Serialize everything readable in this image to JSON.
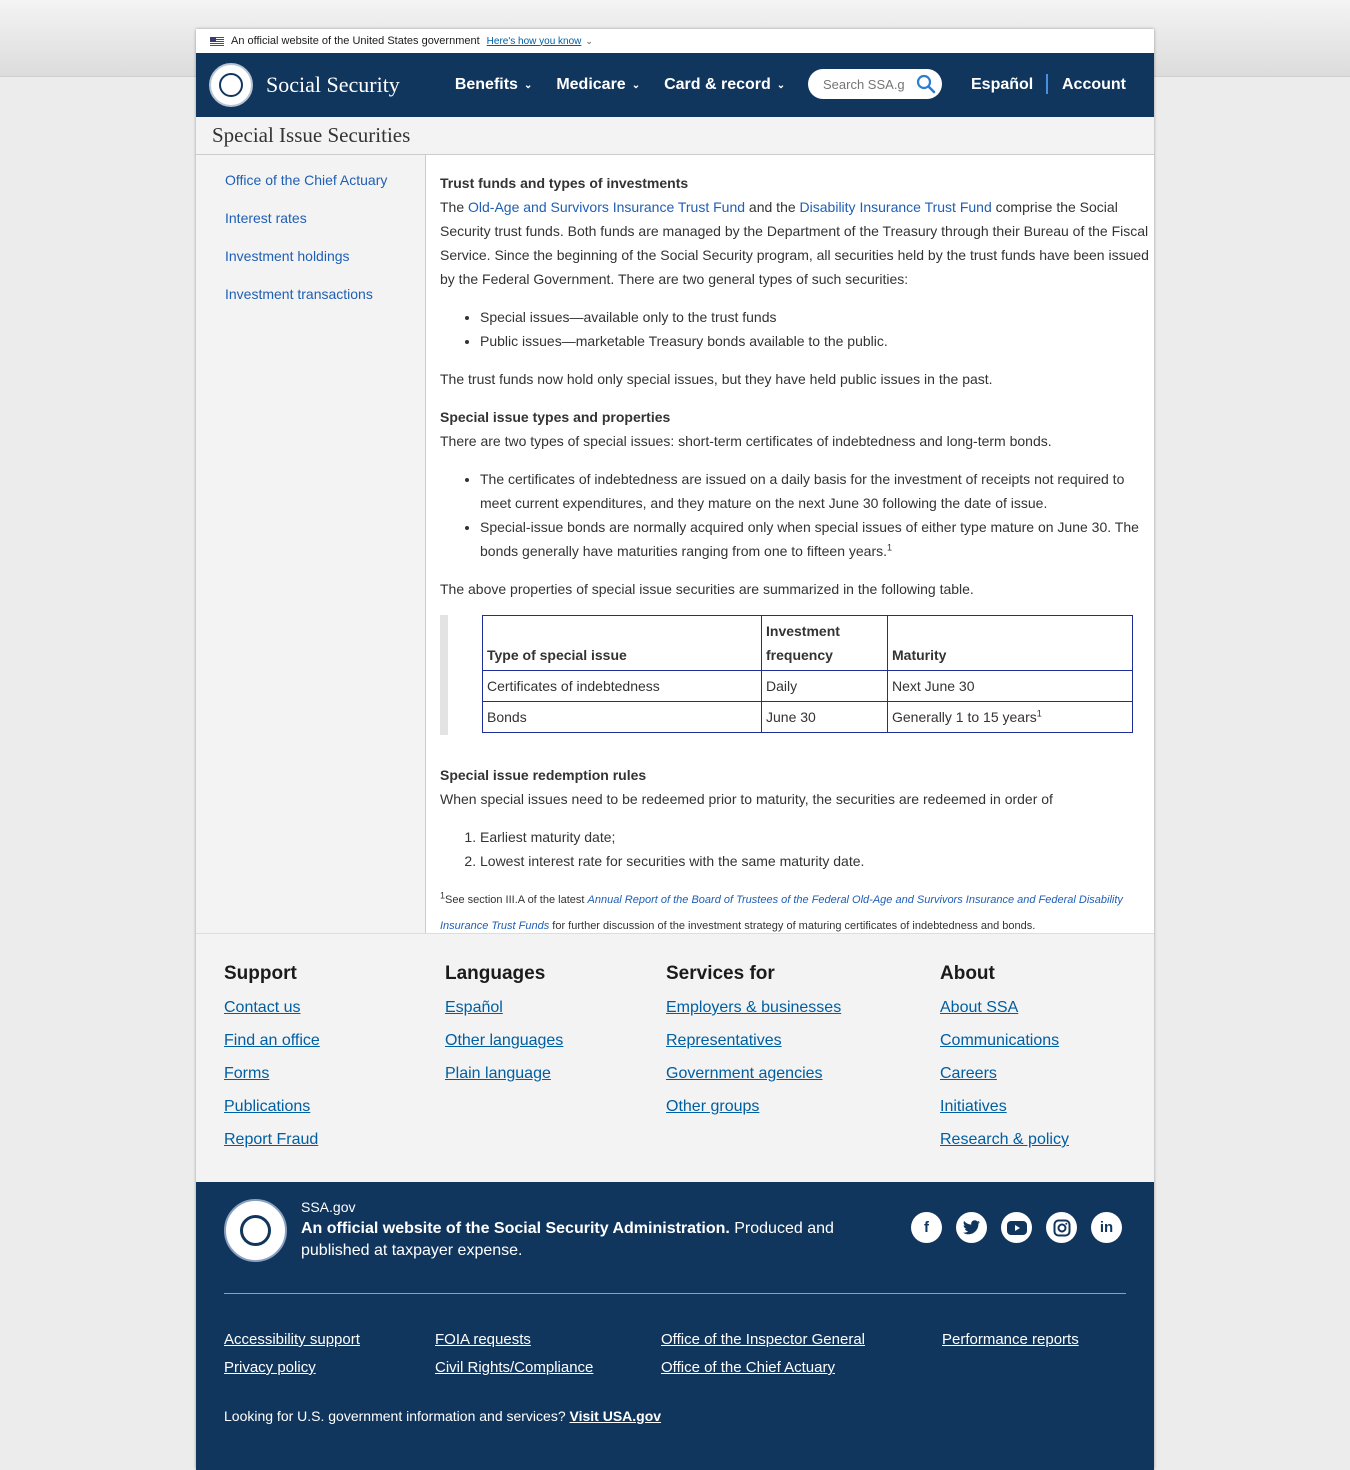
{
  "banner": {
    "text": "An official website of the United States government",
    "how_link": "Here's how you know"
  },
  "header": {
    "brand": "Social Security",
    "nav": [
      "Benefits",
      "Medicare",
      "Card & record"
    ],
    "search_placeholder": "Search SSA.gov",
    "espanol": "Español",
    "account": "Account"
  },
  "page_title": "Special Issue Securities",
  "sidebar": [
    "Office of the Chief Actuary",
    "Interest rates",
    "Investment holdings",
    "Investment transactions"
  ],
  "main": {
    "h1": "Trust funds and types of investments",
    "p1_a": "The ",
    "p1_link1": "Old-Age and Survivors Insurance Trust Fund",
    "p1_b": " and the ",
    "p1_link2": "Disability Insurance Trust Fund",
    "p1_c": " comprise the Social Security trust funds. Both funds are managed by the Department of the Treasury through their Bureau of the Fiscal Service. Since the beginning of the Social Security program, all securities held by the trust funds have been issued by the Federal Government. There are two general types of such securities:",
    "list1": [
      "Special issues—available only to the trust funds",
      "Public issues—marketable Treasury bonds available to the public."
    ],
    "p2": "The trust funds now hold only special issues, but they have held public issues in the past.",
    "h2": "Special issue types and properties",
    "p3": "There are two types of special issues: short-term certificates of indebtedness and long-term bonds.",
    "list2": [
      "The certificates of indebtedness are issued on a daily basis for the investment of receipts not required to meet current expenditures, and they mature on the next June 30 following the date of issue.",
      "Special-issue bonds are normally acquired only when special issues of either type mature on June 30. The bonds generally have maturities ranging from one to fifteen years."
    ],
    "sup": "1",
    "p4": "The above properties of special issue securities are summarized in the following table.",
    "table": {
      "headers": [
        "Type of special issue",
        "Investment frequency",
        "Maturity"
      ],
      "rows": [
        [
          "Certificates of indebtedness",
          "Daily",
          "Next June 30"
        ],
        [
          "Bonds",
          "June 30",
          "Generally 1 to 15 years"
        ]
      ]
    },
    "h3": "Special issue redemption rules",
    "p5": "When special issues need to be redeemed prior to maturity, the securities are redeemed in order of",
    "list3": [
      "Earliest maturity date;",
      "Lowest interest rate for securities with the same maturity date."
    ],
    "fn_a": "See section III.A of the latest ",
    "fn_link": "Annual Report of the Board of Trustees of the Federal Old-Age and Survivors Insurance and Federal Disability Insurance Trust Funds",
    "fn_b": " for further discussion of the investment strategy of maturing certificates of indebtedness and bonds."
  },
  "footer": {
    "cols": [
      {
        "title": "Support",
        "links": [
          "Contact us",
          "Find an office",
          "Forms",
          "Publications",
          "Report Fraud"
        ]
      },
      {
        "title": "Languages",
        "links": [
          "Español",
          "Other languages",
          "Plain language"
        ]
      },
      {
        "title": "Services for",
        "links": [
          "Employers & businesses",
          "Representatives",
          "Government agencies",
          "Other groups"
        ]
      },
      {
        "title": "About",
        "links": [
          "About SSA",
          "Communications",
          "Careers",
          "Initiatives",
          "Research & policy"
        ]
      }
    ],
    "site": "SSA.gov",
    "official_bold": "An official website of the Social Security Administration.",
    "official_rest": " Produced and published at taxpayer expense.",
    "bottom_links": [
      "Accessibility support",
      "Privacy policy",
      "FOIA requests",
      "Civil Rights/Compliance",
      "Office of the Inspector General",
      "Office of the Chief Actuary",
      "Performance reports"
    ],
    "usa_text": "Looking for U.S. government information and services? ",
    "usa_link": "Visit USA.gov",
    "social": [
      "facebook-icon",
      "twitter-icon",
      "youtube-icon",
      "instagram-icon",
      "linkedin-icon"
    ]
  }
}
